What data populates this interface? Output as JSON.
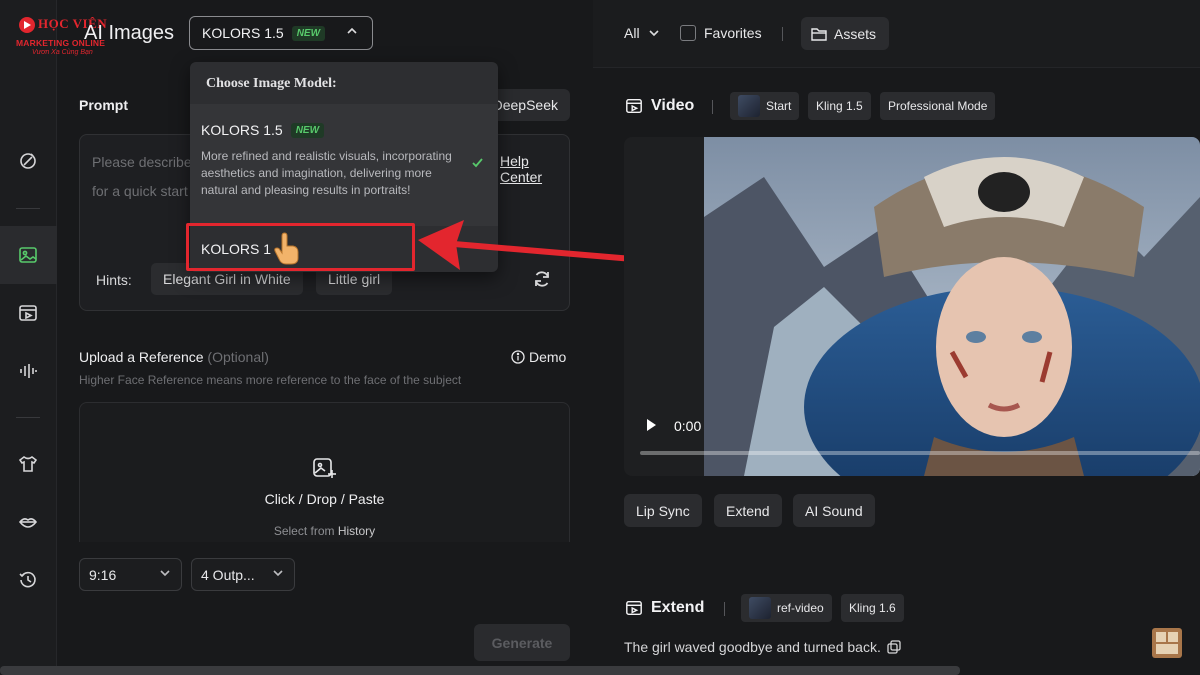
{
  "logo": {
    "main": "HỌC VIỆN",
    "sub": "MARKETING ONLINE",
    "tagline": "Vươn Xa Cùng Bạn"
  },
  "header": {
    "title": "AI Images",
    "model_selected": "KOLORS 1.5",
    "model_badge": "NEW"
  },
  "dropdown": {
    "heading": "Choose Image Model:",
    "items": [
      {
        "name": "KOLORS 1.5",
        "badge": "NEW",
        "description": "More refined and realistic visuals, incorporating aesthetics and imagination, delivering more natural and pleasing results in portraits!",
        "selected": true
      },
      {
        "name": "KOLORS 1"
      }
    ]
  },
  "prompt": {
    "label": "Prompt",
    "deepseek_label": "DeepSeek",
    "placeholder_line1": "Please describe",
    "placeholder_line2": "for a quick start",
    "help_link": "Help Center",
    "hints_label": "Hints:",
    "hints": [
      "Elegant Girl in White",
      "Little girl"
    ]
  },
  "upload": {
    "title": "Upload a Reference",
    "optional": "(Optional)",
    "hint": "Higher Face Reference means more reference to the face of the subject",
    "demo": "Demo",
    "cta": "Click / Drop / Paste",
    "select_from": "Select from",
    "history": "History"
  },
  "options": {
    "ratio": "9:16",
    "outputs": "4 Outp..."
  },
  "generate_label": "Generate",
  "right_header": {
    "filter": "All",
    "favorites": "Favorites",
    "assets": "Assets"
  },
  "video_block": {
    "title": "Video",
    "tags": [
      "Start",
      "Kling 1.5",
      "Professional Mode"
    ],
    "time": "0:00",
    "progress": 0,
    "actions": [
      "Lip Sync",
      "Extend",
      "AI Sound"
    ]
  },
  "extend_block": {
    "title": "Extend",
    "tags": [
      "ref-video",
      "Kling 1.6"
    ],
    "caption": "The girl waved goodbye and turned back."
  },
  "colors": {
    "accent_green": "#58c96b",
    "highlight_red": "#e3262e",
    "bg": "#18191b"
  }
}
